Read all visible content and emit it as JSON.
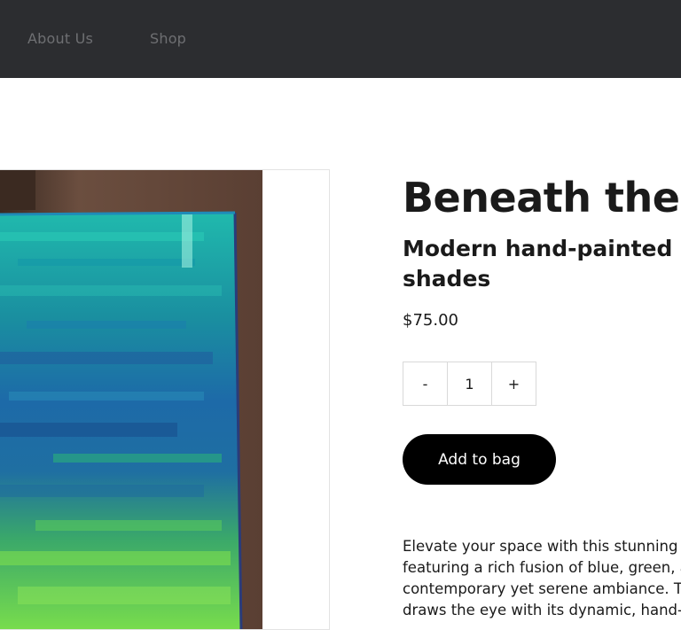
{
  "nav": {
    "items": [
      {
        "label": "About Us"
      },
      {
        "label": "Shop"
      }
    ]
  },
  "product": {
    "title": "Beneath the",
    "subtitle": "Modern hand-painted w shades",
    "price": "$75.00",
    "quantity": {
      "decrement_label": "-",
      "value": "1",
      "increment_label": "+"
    },
    "add_to_bag_label": "Add to bag",
    "description_lines": [
      "Elevate your space with this stunning a",
      "featuring a rich fusion of blue, green, a",
      "contemporary yet serene ambiance. T",
      "draws the eye with its dynamic, hand-"
    ]
  },
  "colors": {
    "header_bg": "#2c2d30",
    "nav_text": "#6e6f72",
    "button_bg": "#000000",
    "button_text": "#ffffff",
    "text": "#1a1a1a",
    "painting_teal": "#1fb3a8",
    "painting_blue": "#1e5a9c",
    "painting_green": "#6ed34a"
  }
}
